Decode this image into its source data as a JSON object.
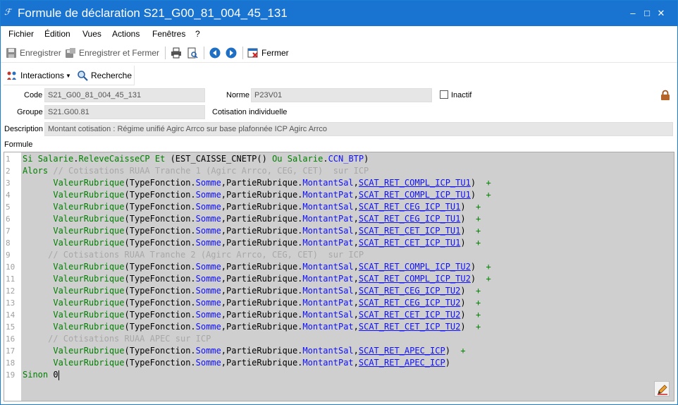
{
  "window": {
    "title": "Formule de déclaration S21_G00_81_004_45_131",
    "app_icon_glyph": "ℱ",
    "controls": {
      "minimize": "–",
      "maximize": "□",
      "close": "✕"
    }
  },
  "menu": [
    "Fichier",
    "Édition",
    "Vues",
    "Actions",
    "Fenêtres",
    "?"
  ],
  "toolbar": {
    "save": "Enregistrer",
    "save_close": "Enregistrer et Fermer",
    "close": "Fermer"
  },
  "toolbar2": {
    "interactions": "Interactions",
    "recherche": "Recherche"
  },
  "form": {
    "code_label": "Code",
    "code_value": "S21_G00_81_004_45_131",
    "norme_label": "Norme",
    "norme_value": "P23V01",
    "inactif_label": "Inactif",
    "groupe_label": "Groupe",
    "groupe_value": "S21.G00.81",
    "cotisation_text": "Cotisation individuelle",
    "description_label": "Description",
    "description_value": "Montant cotisation : Régime unifié Agirc Arrco sur base plafonnée ICP Agirc Arrco",
    "formule_label": "Formule"
  },
  "formula_lines": [
    {
      "n": "1",
      "tokens": [
        {
          "t": "kw",
          "v": "Si "
        },
        {
          "t": "fn",
          "v": "Salarie"
        },
        {
          "t": "pl",
          "v": "."
        },
        {
          "t": "fn",
          "v": "ReleveCaisseCP"
        },
        {
          "t": "pl",
          "v": " "
        },
        {
          "t": "kw",
          "v": "Et"
        },
        {
          "t": "pl",
          "v": " (EST_CAISSE_CNETP() "
        },
        {
          "t": "kw",
          "v": "Ou"
        },
        {
          "t": "pl",
          "v": " "
        },
        {
          "t": "fn",
          "v": "Salarie"
        },
        {
          "t": "pl",
          "v": "."
        },
        {
          "t": "prop",
          "v": "CCN_BTP"
        },
        {
          "t": "pl",
          "v": ")"
        }
      ]
    },
    {
      "n": "2",
      "tokens": [
        {
          "t": "kw",
          "v": "Alors"
        },
        {
          "t": "cm",
          "v": " // Cotisations RUAA Tranche 1 (Agirc Arrco, CEG, CET)  sur ICP"
        }
      ]
    },
    {
      "n": "3",
      "tokens": [
        {
          "t": "pl",
          "v": "      "
        },
        {
          "t": "fn",
          "v": "ValeurRubrique"
        },
        {
          "t": "pl",
          "v": "(TypeFonction."
        },
        {
          "t": "prop",
          "v": "Somme"
        },
        {
          "t": "pl",
          "v": ",PartieRubrique."
        },
        {
          "t": "prop",
          "v": "MontantSal"
        },
        {
          "t": "pl",
          "v": ","
        },
        {
          "t": "cst",
          "v": "SCAT_RET_COMPL_ICP_TU1"
        },
        {
          "t": "pl",
          "v": ")"
        },
        {
          "t": "kw",
          "v": "  +"
        }
      ]
    },
    {
      "n": "4",
      "tokens": [
        {
          "t": "pl",
          "v": "      "
        },
        {
          "t": "fn",
          "v": "ValeurRubrique"
        },
        {
          "t": "pl",
          "v": "(TypeFonction."
        },
        {
          "t": "prop",
          "v": "Somme"
        },
        {
          "t": "pl",
          "v": ",PartieRubrique."
        },
        {
          "t": "prop",
          "v": "MontantPat"
        },
        {
          "t": "pl",
          "v": ","
        },
        {
          "t": "cst",
          "v": "SCAT_RET_COMPL_ICP_TU1"
        },
        {
          "t": "pl",
          "v": ")"
        },
        {
          "t": "kw",
          "v": "  +"
        }
      ]
    },
    {
      "n": "5",
      "tokens": [
        {
          "t": "pl",
          "v": "      "
        },
        {
          "t": "fn",
          "v": "ValeurRubrique"
        },
        {
          "t": "pl",
          "v": "(TypeFonction."
        },
        {
          "t": "prop",
          "v": "Somme"
        },
        {
          "t": "pl",
          "v": ",PartieRubrique."
        },
        {
          "t": "prop",
          "v": "MontantSal"
        },
        {
          "t": "pl",
          "v": ","
        },
        {
          "t": "cst",
          "v": "SCAT_RET_CEG_ICP_TU1"
        },
        {
          "t": "pl",
          "v": ")"
        },
        {
          "t": "kw",
          "v": "  +"
        }
      ]
    },
    {
      "n": "6",
      "tokens": [
        {
          "t": "pl",
          "v": "      "
        },
        {
          "t": "fn",
          "v": "ValeurRubrique"
        },
        {
          "t": "pl",
          "v": "(TypeFonction."
        },
        {
          "t": "prop",
          "v": "Somme"
        },
        {
          "t": "pl",
          "v": ",PartieRubrique."
        },
        {
          "t": "prop",
          "v": "MontantPat"
        },
        {
          "t": "pl",
          "v": ","
        },
        {
          "t": "cst",
          "v": "SCAT_RET_CEG_ICP_TU1"
        },
        {
          "t": "pl",
          "v": ")"
        },
        {
          "t": "kw",
          "v": "  +"
        }
      ]
    },
    {
      "n": "7",
      "tokens": [
        {
          "t": "pl",
          "v": "      "
        },
        {
          "t": "fn",
          "v": "ValeurRubrique"
        },
        {
          "t": "pl",
          "v": "(TypeFonction."
        },
        {
          "t": "prop",
          "v": "Somme"
        },
        {
          "t": "pl",
          "v": ",PartieRubrique."
        },
        {
          "t": "prop",
          "v": "MontantSal"
        },
        {
          "t": "pl",
          "v": ","
        },
        {
          "t": "cst",
          "v": "SCAT_RET_CET_ICP_TU1"
        },
        {
          "t": "pl",
          "v": ")"
        },
        {
          "t": "kw",
          "v": "  +"
        }
      ]
    },
    {
      "n": "8",
      "tokens": [
        {
          "t": "pl",
          "v": "      "
        },
        {
          "t": "fn",
          "v": "ValeurRubrique"
        },
        {
          "t": "pl",
          "v": "(TypeFonction."
        },
        {
          "t": "prop",
          "v": "Somme"
        },
        {
          "t": "pl",
          "v": ",PartieRubrique."
        },
        {
          "t": "prop",
          "v": "MontantPat"
        },
        {
          "t": "pl",
          "v": ","
        },
        {
          "t": "cst",
          "v": "SCAT_RET_CET_ICP_TU1"
        },
        {
          "t": "pl",
          "v": ")"
        },
        {
          "t": "kw",
          "v": "  +"
        }
      ]
    },
    {
      "n": "9",
      "tokens": [
        {
          "t": "cm",
          "v": "     // Cotisations RUAA Tranche 2 (Agirc Arrco, CEG, CET)  sur ICP"
        }
      ]
    },
    {
      "n": "10",
      "tokens": [
        {
          "t": "pl",
          "v": "      "
        },
        {
          "t": "fn",
          "v": "ValeurRubrique"
        },
        {
          "t": "pl",
          "v": "(TypeFonction."
        },
        {
          "t": "prop",
          "v": "Somme"
        },
        {
          "t": "pl",
          "v": ",PartieRubrique."
        },
        {
          "t": "prop",
          "v": "MontantSal"
        },
        {
          "t": "pl",
          "v": ","
        },
        {
          "t": "cst",
          "v": "SCAT_RET_COMPL_ICP_TU2"
        },
        {
          "t": "pl",
          "v": ")"
        },
        {
          "t": "kw",
          "v": "  +"
        }
      ]
    },
    {
      "n": "11",
      "tokens": [
        {
          "t": "pl",
          "v": "      "
        },
        {
          "t": "fn",
          "v": "ValeurRubrique"
        },
        {
          "t": "pl",
          "v": "(TypeFonction."
        },
        {
          "t": "prop",
          "v": "Somme"
        },
        {
          "t": "pl",
          "v": ",PartieRubrique."
        },
        {
          "t": "prop",
          "v": "MontantPat"
        },
        {
          "t": "pl",
          "v": ","
        },
        {
          "t": "cst",
          "v": "SCAT_RET_COMPL_ICP_TU2"
        },
        {
          "t": "pl",
          "v": ")"
        },
        {
          "t": "kw",
          "v": "  +"
        }
      ]
    },
    {
      "n": "12",
      "tokens": [
        {
          "t": "pl",
          "v": "      "
        },
        {
          "t": "fn",
          "v": "ValeurRubrique"
        },
        {
          "t": "pl",
          "v": "(TypeFonction."
        },
        {
          "t": "prop",
          "v": "Somme"
        },
        {
          "t": "pl",
          "v": ",PartieRubrique."
        },
        {
          "t": "prop",
          "v": "MontantSal"
        },
        {
          "t": "pl",
          "v": ","
        },
        {
          "t": "cst",
          "v": "SCAT_RET_CEG_ICP_TU2"
        },
        {
          "t": "pl",
          "v": ")"
        },
        {
          "t": "kw",
          "v": "  +"
        }
      ]
    },
    {
      "n": "13",
      "tokens": [
        {
          "t": "pl",
          "v": "      "
        },
        {
          "t": "fn",
          "v": "ValeurRubrique"
        },
        {
          "t": "pl",
          "v": "(TypeFonction."
        },
        {
          "t": "prop",
          "v": "Somme"
        },
        {
          "t": "pl",
          "v": ",PartieRubrique."
        },
        {
          "t": "prop",
          "v": "MontantPat"
        },
        {
          "t": "pl",
          "v": ","
        },
        {
          "t": "cst",
          "v": "SCAT_RET_CEG_ICP_TU2"
        },
        {
          "t": "pl",
          "v": ")"
        },
        {
          "t": "kw",
          "v": "  +"
        }
      ]
    },
    {
      "n": "14",
      "tokens": [
        {
          "t": "pl",
          "v": "      "
        },
        {
          "t": "fn",
          "v": "ValeurRubrique"
        },
        {
          "t": "pl",
          "v": "(TypeFonction."
        },
        {
          "t": "prop",
          "v": "Somme"
        },
        {
          "t": "pl",
          "v": ",PartieRubrique."
        },
        {
          "t": "prop",
          "v": "MontantSal"
        },
        {
          "t": "pl",
          "v": ","
        },
        {
          "t": "cst",
          "v": "SCAT_RET_CET_ICP_TU2"
        },
        {
          "t": "pl",
          "v": ")"
        },
        {
          "t": "kw",
          "v": "  +"
        }
      ]
    },
    {
      "n": "15",
      "tokens": [
        {
          "t": "pl",
          "v": "      "
        },
        {
          "t": "fn",
          "v": "ValeurRubrique"
        },
        {
          "t": "pl",
          "v": "(TypeFonction."
        },
        {
          "t": "prop",
          "v": "Somme"
        },
        {
          "t": "pl",
          "v": ",PartieRubrique."
        },
        {
          "t": "prop",
          "v": "MontantPat"
        },
        {
          "t": "pl",
          "v": ","
        },
        {
          "t": "cst",
          "v": "SCAT_RET_CET_ICP_TU2"
        },
        {
          "t": "pl",
          "v": ")"
        },
        {
          "t": "kw",
          "v": "  +"
        }
      ]
    },
    {
      "n": "16",
      "tokens": [
        {
          "t": "cm",
          "v": "     // Cotisations RUAA APEC sur ICP"
        }
      ]
    },
    {
      "n": "17",
      "tokens": [
        {
          "t": "pl",
          "v": "      "
        },
        {
          "t": "fn",
          "v": "ValeurRubrique"
        },
        {
          "t": "pl",
          "v": "(TypeFonction."
        },
        {
          "t": "prop",
          "v": "Somme"
        },
        {
          "t": "pl",
          "v": ",PartieRubrique."
        },
        {
          "t": "prop",
          "v": "MontantSal"
        },
        {
          "t": "pl",
          "v": ","
        },
        {
          "t": "cst",
          "v": "SCAT_RET_APEC_ICP"
        },
        {
          "t": "pl",
          "v": ")"
        },
        {
          "t": "kw",
          "v": "  +"
        }
      ]
    },
    {
      "n": "18",
      "tokens": [
        {
          "t": "pl",
          "v": "      "
        },
        {
          "t": "fn",
          "v": "ValeurRubrique"
        },
        {
          "t": "pl",
          "v": "(TypeFonction."
        },
        {
          "t": "prop",
          "v": "Somme"
        },
        {
          "t": "pl",
          "v": ",PartieRubrique."
        },
        {
          "t": "prop",
          "v": "MontantPat"
        },
        {
          "t": "pl",
          "v": ","
        },
        {
          "t": "cst",
          "v": "SCAT_RET_APEC_ICP"
        },
        {
          "t": "pl",
          "v": ")"
        }
      ]
    },
    {
      "n": "19",
      "tokens": [
        {
          "t": "kw",
          "v": "Sinon"
        },
        {
          "t": "pl",
          "v": " 0"
        }
      ]
    }
  ],
  "colors": {
    "titlebar": "#1874d0",
    "keyword": "#008000",
    "property": "#1010ff",
    "comment": "#a8a8a8",
    "editor_bg": "#cfcfcf"
  },
  "icons": [
    "save-icon",
    "save-close-icon",
    "print-icon",
    "print-preview-icon",
    "back-icon",
    "forward-icon",
    "close-doc-icon",
    "interactions-icon",
    "search-icon",
    "lock-icon",
    "pencil-icon"
  ]
}
